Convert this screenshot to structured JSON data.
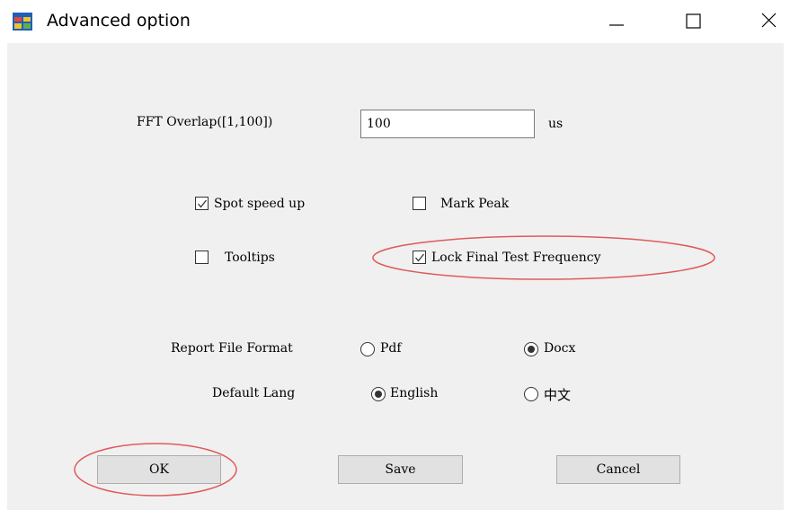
{
  "window": {
    "title": "Advanced option",
    "icon": "app-window-icon"
  },
  "fft": {
    "label": "FFT Overlap([1,100])",
    "value": "100",
    "unit": "us"
  },
  "checkboxes": {
    "spot_speed_up": {
      "label": "Spot speed up",
      "checked": true
    },
    "mark_peak": {
      "label": "Mark Peak",
      "checked": false
    },
    "tooltips": {
      "label": "Tooltips",
      "checked": false
    },
    "lock_final": {
      "label": "Lock Final Test Frequency",
      "checked": true
    }
  },
  "report_format": {
    "label": "Report File Format",
    "options": [
      {
        "label": "Pdf",
        "selected": false
      },
      {
        "label": "Docx",
        "selected": true
      }
    ]
  },
  "default_lang": {
    "label": "Default Lang",
    "options": [
      {
        "label": "English",
        "selected": true
      },
      {
        "label": "中文",
        "selected": false
      }
    ]
  },
  "buttons": {
    "ok": "OK",
    "save": "Save",
    "cancel": "Cancel"
  },
  "colors": {
    "client_bg": "#f0f0f0",
    "highlight_ellipse": "#e05a5a",
    "button_bg": "#e1e1e1"
  }
}
